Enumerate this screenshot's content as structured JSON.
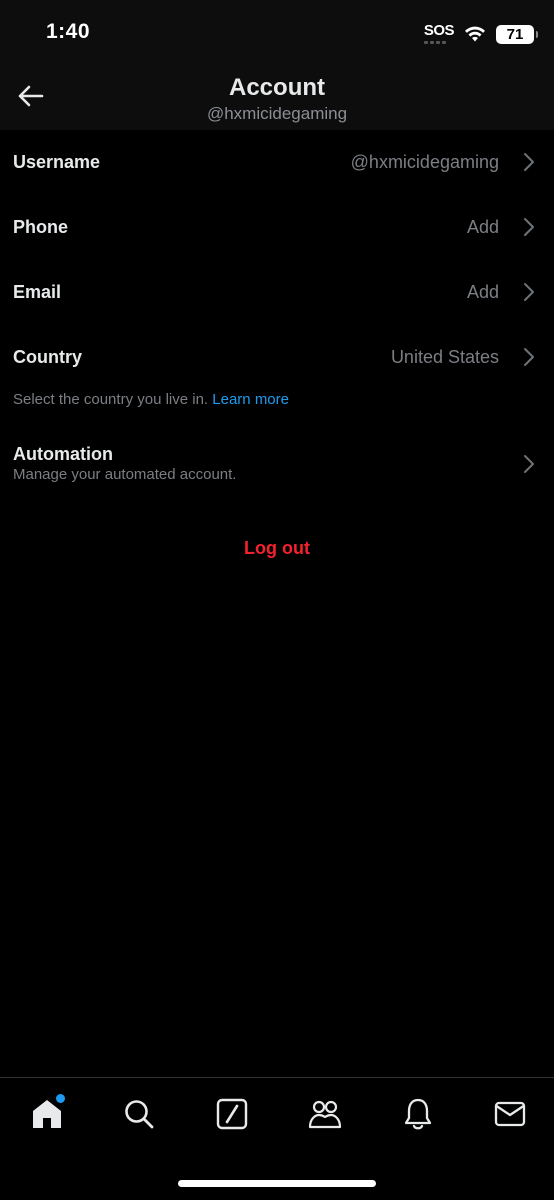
{
  "status_bar": {
    "time": "1:40",
    "sos": "SOS",
    "battery": "71"
  },
  "header": {
    "title": "Account",
    "subtitle": "@hxmicidegaming"
  },
  "rows": [
    {
      "label": "Username",
      "value": "@hxmicidegaming"
    },
    {
      "label": "Phone",
      "value": "Add"
    },
    {
      "label": "Email",
      "value": "Add"
    },
    {
      "label": "Country",
      "value": "United States"
    }
  ],
  "country_helper": {
    "text": "Select the country you live in.",
    "link": "Learn more"
  },
  "automation": {
    "title": "Automation",
    "subtitle": "Manage your automated account."
  },
  "logout_label": "Log out",
  "colors": {
    "accent": "#1d9bf0",
    "danger": "#f4212e",
    "text": "#e7e9ea",
    "muted": "#7b7f84"
  },
  "bottom_nav": [
    "home-icon",
    "search-icon",
    "grok-icon",
    "communities-icon",
    "notifications-icon",
    "messages-icon"
  ]
}
